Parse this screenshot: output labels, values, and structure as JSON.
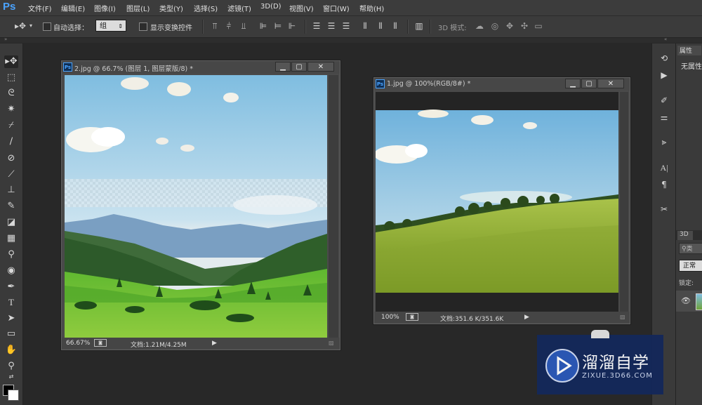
{
  "app": {
    "logo": "Ps"
  },
  "menu": [
    "文件(F)",
    "编辑(E)",
    "图像(I)",
    "图层(L)",
    "类型(Y)",
    "选择(S)",
    "滤镜(T)",
    "3D(D)",
    "视图(V)",
    "窗口(W)",
    "帮助(H)"
  ],
  "options": {
    "auto_select_label": "自动选择：",
    "auto_select_value": "组",
    "show_transform_label": "显示变换控件",
    "mode_3d_label": "3D 模式:"
  },
  "windows": {
    "doc2": {
      "title": "2.jpg @ 66.7% (图层 1, 图层蒙版/8) *",
      "zoom": "66.67%",
      "doc_info": "文档:1.21M/4.25M"
    },
    "doc1": {
      "title": "1.jpg @ 100%(RGB/8#) *",
      "zoom": "100%",
      "doc_info": "文档:351.6 K/351.6K"
    }
  },
  "panels": {
    "properties_tab": "属性",
    "no_properties": "无属性",
    "tab_3d": "3D",
    "search_placeholder": "类",
    "blend_mode": "正常",
    "lock_label": "锁定:"
  },
  "watermark": {
    "brand": "溜溜自学",
    "url": "ZIXUE.3D66.COM"
  },
  "icons": [
    "move-icon",
    "marquee-icon",
    "lasso-icon",
    "magic-wand-icon",
    "crop-icon",
    "eyedropper-icon",
    "healing-brush-icon",
    "brush-icon",
    "stamp-icon",
    "history-brush-icon",
    "eraser-icon",
    "gradient-icon",
    "blur-icon",
    "dodge-icon",
    "pen-icon",
    "type-icon",
    "path-select-icon",
    "rectangle-icon",
    "hand-icon",
    "zoom-icon"
  ],
  "colors": {
    "ps_blue": "#4aa3ff",
    "chrome": "#3b3b3b",
    "workspace": "#282828"
  }
}
